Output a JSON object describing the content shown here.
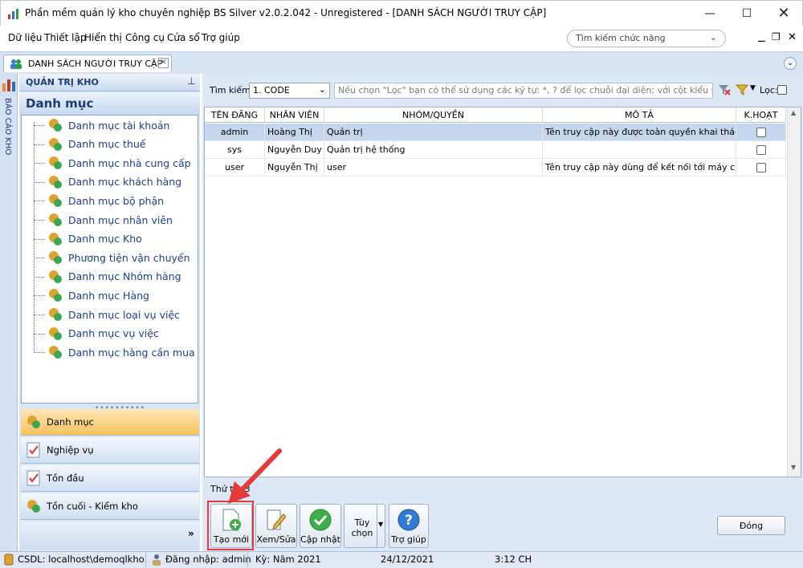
{
  "window": {
    "title": "Phần mềm quản lý kho chuyên nghiệp BS Silver v2.0.2.042 - Unregistered - [DANH SÁCH NGƯỜI TRUY CẬP]"
  },
  "menu": [
    {
      "label": "Dữ liệu"
    },
    {
      "label": "Thiết lập"
    },
    {
      "label": "Hiển thị"
    },
    {
      "label": "Công cụ"
    },
    {
      "label": "Cửa sổ"
    },
    {
      "label": "Trợ giúp"
    }
  ],
  "function_search": {
    "placeholder": "Tìm kiếm chức năng"
  },
  "doc_tab": {
    "label": "DANH SÁCH NGƯỜI TRUY CẬP"
  },
  "left_strip": {
    "label": "BÁO CÁO KHO"
  },
  "left_panel": {
    "header": "QUẢN TRỊ KHO",
    "section_title": "Danh mục",
    "tree_items": [
      "Danh mục tài khoản",
      "Danh mục thuế",
      "Danh mục nhà cung cấp",
      "Danh mục khách hàng",
      "Danh mục bộ phận",
      "Danh mục nhân viên",
      "Danh mục Kho",
      "Phương tiện vận chuyển",
      "Danh mục Nhóm hàng",
      "Danh mục Hàng",
      "Danh mục loại vụ việc",
      "Danh mục vụ việc",
      "Danh mục hàng cần mua"
    ],
    "nav_buttons": [
      "Danh mục",
      "Nghiệp vụ",
      "Tồn đầu",
      "Tồn cuối - Kiểm kho"
    ]
  },
  "search": {
    "label": "Tìm kiếm:",
    "field_value": "1. CODE",
    "hint": "Nếu chọn \"Lọc\" bạn có thể sử dụng các ký tự: *, ? để lọc chuỗi đại diện; với cột kiểu số dùng >20 &",
    "filter_label": "Lọc:"
  },
  "grid": {
    "columns": [
      "TÊN ĐĂNG",
      "NHÂN VIÊN",
      "NHÓM/QUYỀN",
      "MÔ TẢ",
      "K.HOẠT"
    ],
    "rows": [
      {
        "login": "admin",
        "employee": "Hoàng Thị",
        "group": "Quản trị",
        "desc": "Tên truy cập này được toàn quyền khai thác hệ"
      },
      {
        "login": "sys",
        "employee": "Nguyễn Duy",
        "group": "Quản trị hệ thống",
        "desc": ""
      },
      {
        "login": "user",
        "employee": "Nguyễn Thị",
        "group": "user",
        "desc": "Tên truy cập này dùng để kết nối tới máy chủ."
      }
    ]
  },
  "order_label": "Thứ tự: 3",
  "toolbar": {
    "new": "Tạo mới",
    "edit": "Xem/Sửa",
    "update": "Cập nhật",
    "options": "Tùy chọn",
    "help": "Trợ giúp",
    "close": "Đóng"
  },
  "status_bar": {
    "db": "CSDL: localhost\\demoqlkho",
    "login": "Đăng nhập: admin",
    "period": "Kỳ: Năm 2021",
    "date": "24/12/2021",
    "time": "3:12 CH"
  },
  "colors": {
    "accent": "#e53a3a",
    "selection": "#c5d7ee",
    "panel": "#d9e6f5"
  }
}
